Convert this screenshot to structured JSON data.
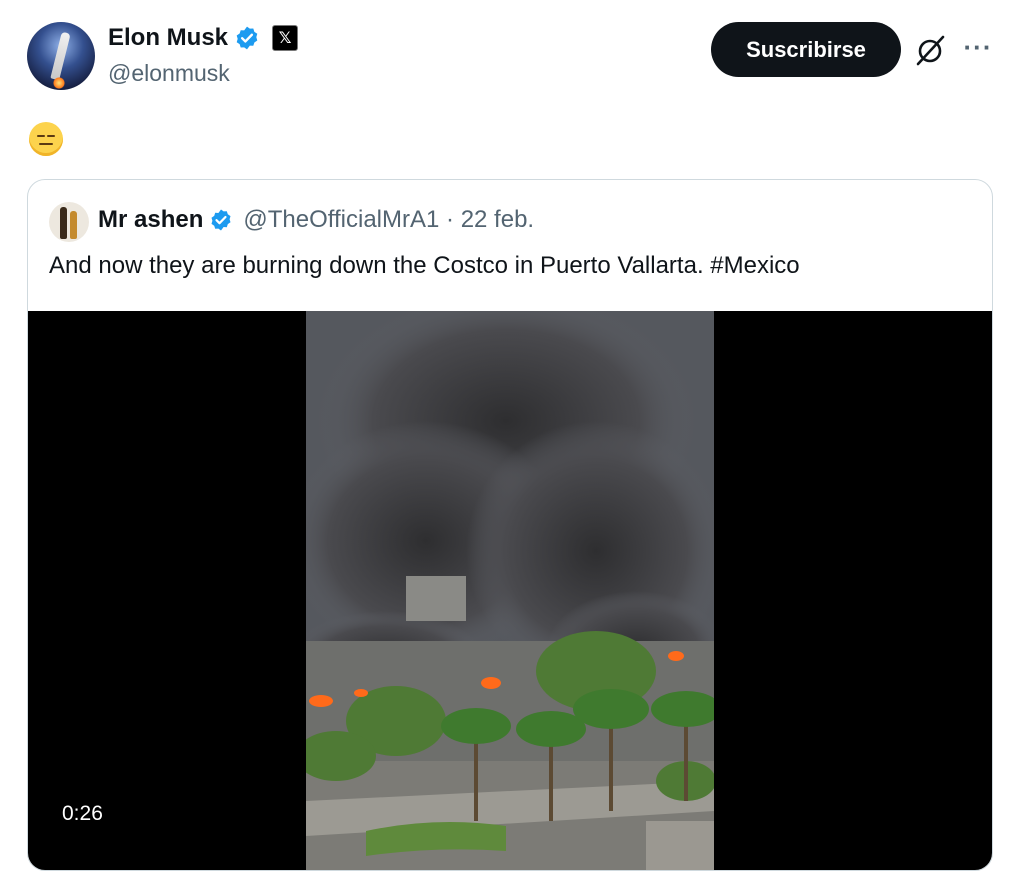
{
  "author": {
    "name": "Elon Musk",
    "handle": "@elonmusk",
    "verified_color": "#1d9bf0",
    "affiliation_badge": "𝕏"
  },
  "actions": {
    "subscribe_label": "Suscribirse",
    "grok_icon": "grok-icon",
    "more_label": "···"
  },
  "post": {
    "emoji": "expressionless-face-emoji"
  },
  "quoted": {
    "name": "Mr ashen",
    "handle": "@TheOfficialMrA1",
    "date_separator": " · ",
    "date": "22 feb.",
    "text": "And now they are burning down the Costco in Puerto Vallarta. #Mexico",
    "video": {
      "duration": "0:26"
    }
  }
}
